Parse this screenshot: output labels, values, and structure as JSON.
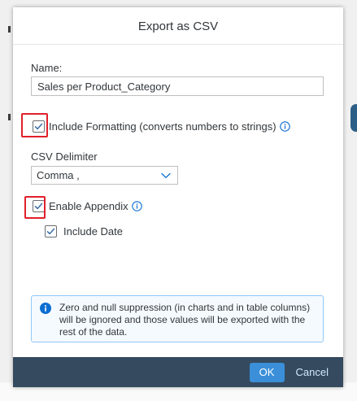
{
  "dialog": {
    "title": "Export as CSV"
  },
  "name_field": {
    "label": "Name:",
    "value": "Sales per Product_Category"
  },
  "include_formatting": {
    "label": "Include Formatting (converts numbers to strings)",
    "checked": true
  },
  "delimiter": {
    "label": "CSV Delimiter",
    "selected": "Comma ,"
  },
  "enable_appendix": {
    "label": "Enable Appendix",
    "checked": true
  },
  "include_date": {
    "label": "Include Date",
    "checked": true
  },
  "info_message": {
    "text": "Zero and null suppression (in charts and in table columns) will be ignored and those values will be exported with the rest of the data."
  },
  "footer": {
    "ok_label": "OK",
    "cancel_label": "Cancel"
  },
  "colors": {
    "accent": "#3a8fd8",
    "footer_bg": "#354a5f",
    "annotation_red": "#e0202a",
    "info_border": "#91c8f6"
  }
}
